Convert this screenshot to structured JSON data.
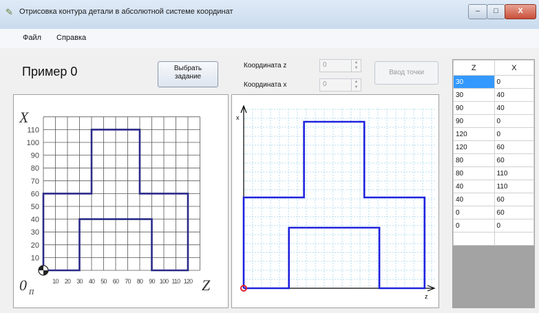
{
  "window": {
    "title": "Отрисовка контура детали в абсолютной системе координат",
    "icon": "pencil-icon",
    "minimize_glyph": "–",
    "maximize_glyph": "□",
    "close_glyph": "X"
  },
  "menu": {
    "file": "Файл",
    "help": "Справка"
  },
  "example_title": "Пример 0",
  "choose_task_button": {
    "line1": "Выбрать",
    "line2": "задание"
  },
  "coord_z": {
    "label": "Координата z",
    "value": "0"
  },
  "coord_x": {
    "label": "Координата x",
    "value": "0"
  },
  "enter_point_button": "Ввод точки",
  "reference_drawing": {
    "axis_x_label": "X",
    "axis_z_label": "Z",
    "origin_label": "0",
    "origin_subscript": "П",
    "y_ticks": [
      "10",
      "20",
      "30",
      "40",
      "50",
      "60",
      "70",
      "80",
      "90",
      "100",
      "110"
    ],
    "x_ticks": [
      "10",
      "20",
      "30",
      "40",
      "50",
      "60",
      "70",
      "80",
      "90",
      "100",
      "110",
      "120"
    ]
  },
  "canvas": {
    "axis_x_label": "x",
    "axis_z_label": "z"
  },
  "table": {
    "headers": [
      "Z",
      "X"
    ],
    "rows": [
      [
        "30",
        "0"
      ],
      [
        "30",
        "40"
      ],
      [
        "90",
        "40"
      ],
      [
        "90",
        "0"
      ],
      [
        "120",
        "0"
      ],
      [
        "120",
        "60"
      ],
      [
        "80",
        "60"
      ],
      [
        "80",
        "110"
      ],
      [
        "40",
        "110"
      ],
      [
        "40",
        "60"
      ],
      [
        "0",
        "60"
      ],
      [
        "0",
        "0"
      ],
      [
        "",
        ""
      ]
    ]
  },
  "contour": {
    "points": [
      [
        0,
        0
      ],
      [
        30,
        0
      ],
      [
        30,
        40
      ],
      [
        90,
        40
      ],
      [
        90,
        0
      ],
      [
        120,
        0
      ],
      [
        120,
        60
      ],
      [
        80,
        60
      ],
      [
        80,
        110
      ],
      [
        40,
        110
      ],
      [
        40,
        60
      ],
      [
        0,
        60
      ],
      [
        0,
        0
      ]
    ],
    "color": "#1e22dd",
    "reference_color": "#2a2a88"
  }
}
